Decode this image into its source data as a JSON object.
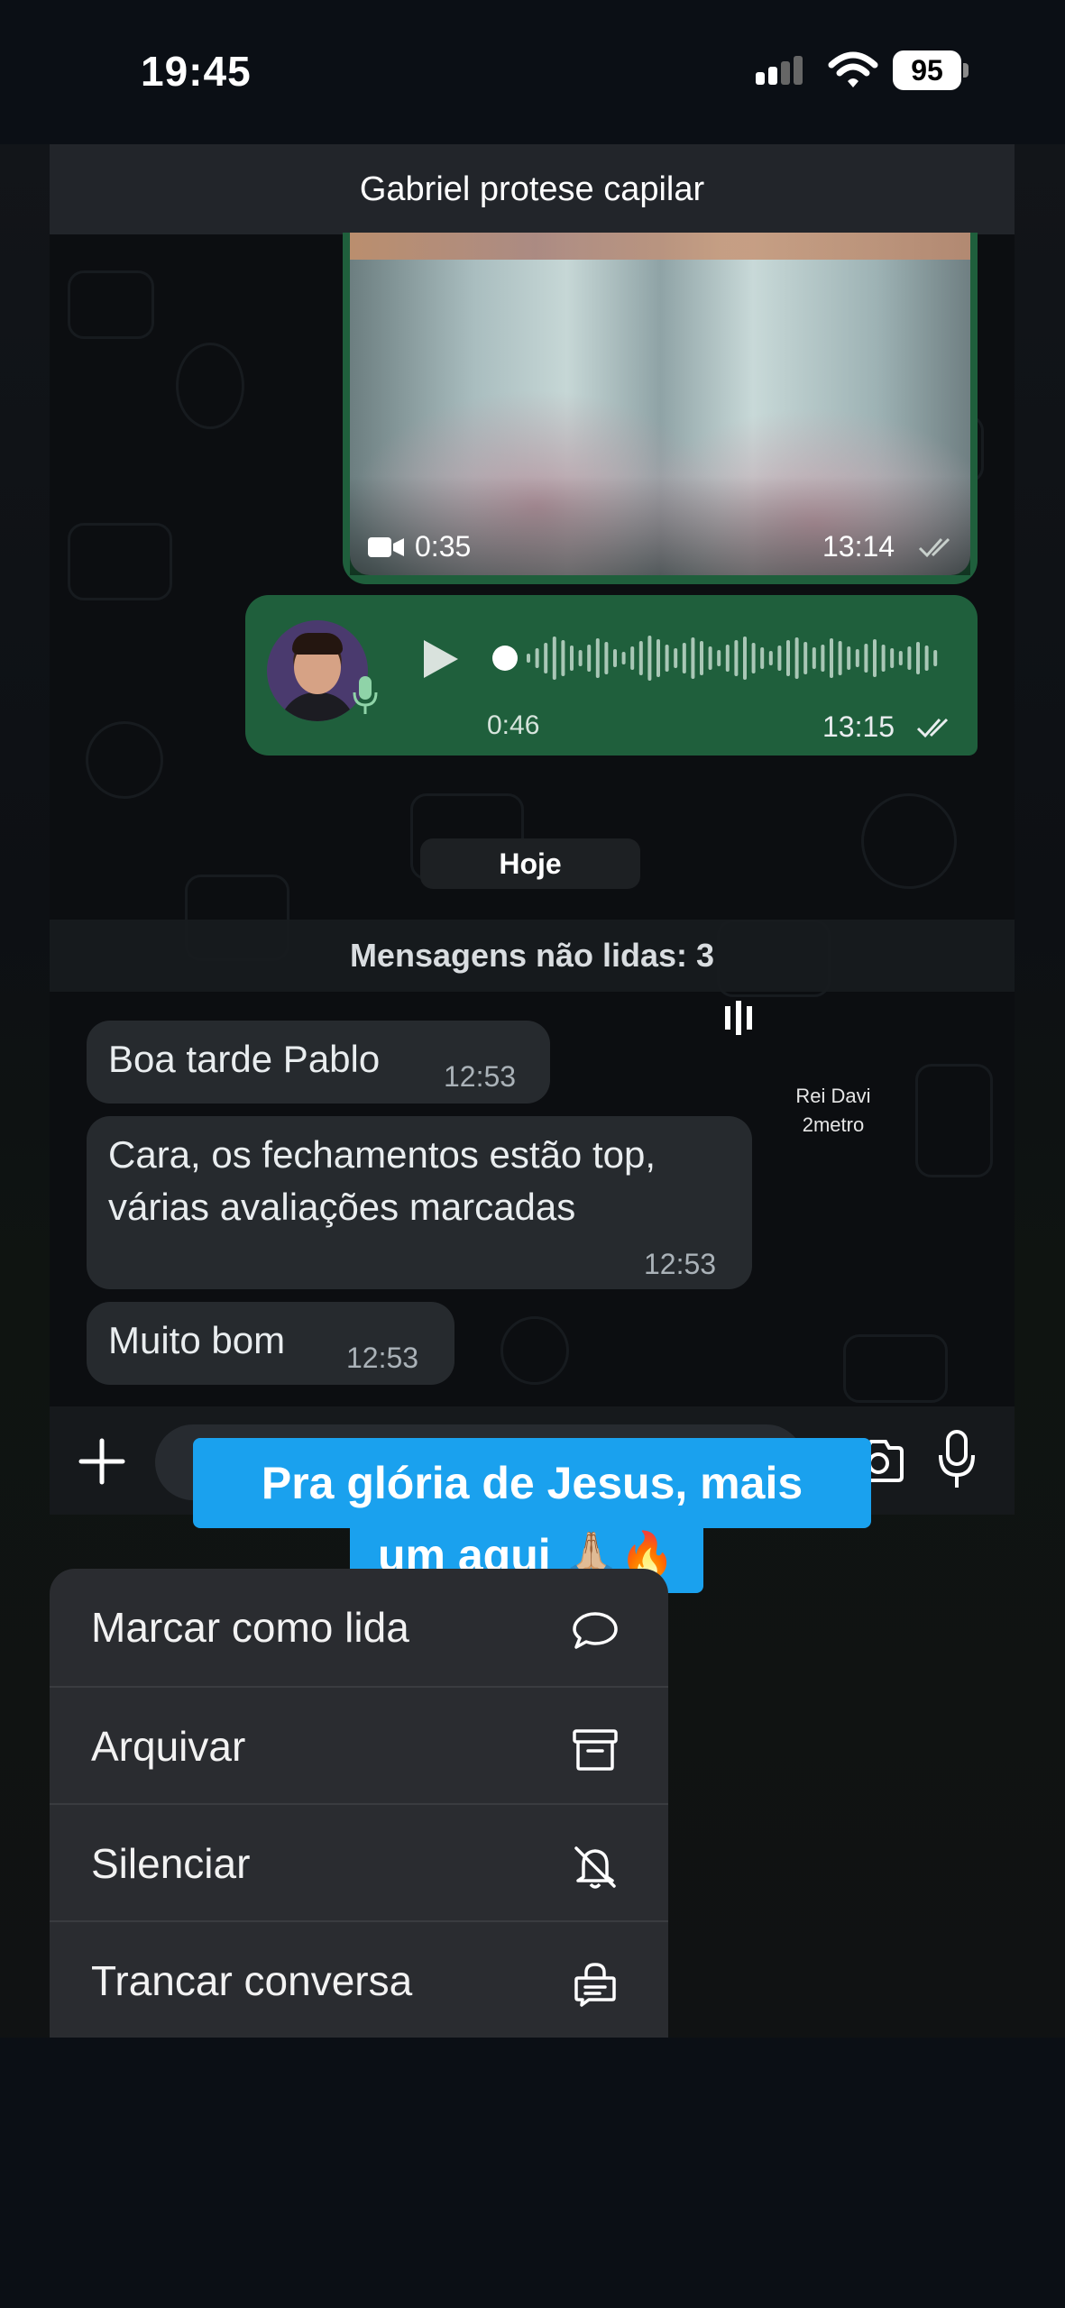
{
  "status_bar": {
    "time": "19:45",
    "battery": "95"
  },
  "chat": {
    "contact_name": "Gabriel protese capilar",
    "video_message": {
      "duration": "0:35",
      "time": "13:14"
    },
    "audio_message": {
      "duration": "0:46",
      "time": "13:15"
    },
    "date_divider": "Hoje",
    "unread_divider": "Mensagens não lidas: 3",
    "overlay_credit_line1": "Rei Davi",
    "overlay_credit_line2": "2metro",
    "messages": [
      {
        "lines": [
          "Boa tarde Pablo"
        ],
        "time": "12:53"
      },
      {
        "lines": [
          "Cara, os fechamentos estão top,",
          "várias avaliações marcadas"
        ],
        "time": "12:53"
      },
      {
        "lines": [
          "Muito bom"
        ],
        "time": "12:53"
      }
    ]
  },
  "caption": {
    "line1": "Pra glória de Jesus, mais",
    "line2": "um aqui 🙏🏼🔥"
  },
  "context_menu": {
    "items": [
      {
        "label": "Marcar como lida",
        "icon": "chat-bubble-icon"
      },
      {
        "label": "Arquivar",
        "icon": "archive-icon"
      },
      {
        "label": "Silenciar",
        "icon": "bell-off-icon"
      },
      {
        "label": "Trancar conversa",
        "icon": "lock-chat-icon"
      }
    ]
  },
  "colors": {
    "outgoing_bubble": "#1f5f3c",
    "incoming_bubble": "#262a2e",
    "caption_bg": "#1aa1ee",
    "menu_bg": "#2a2c30"
  }
}
